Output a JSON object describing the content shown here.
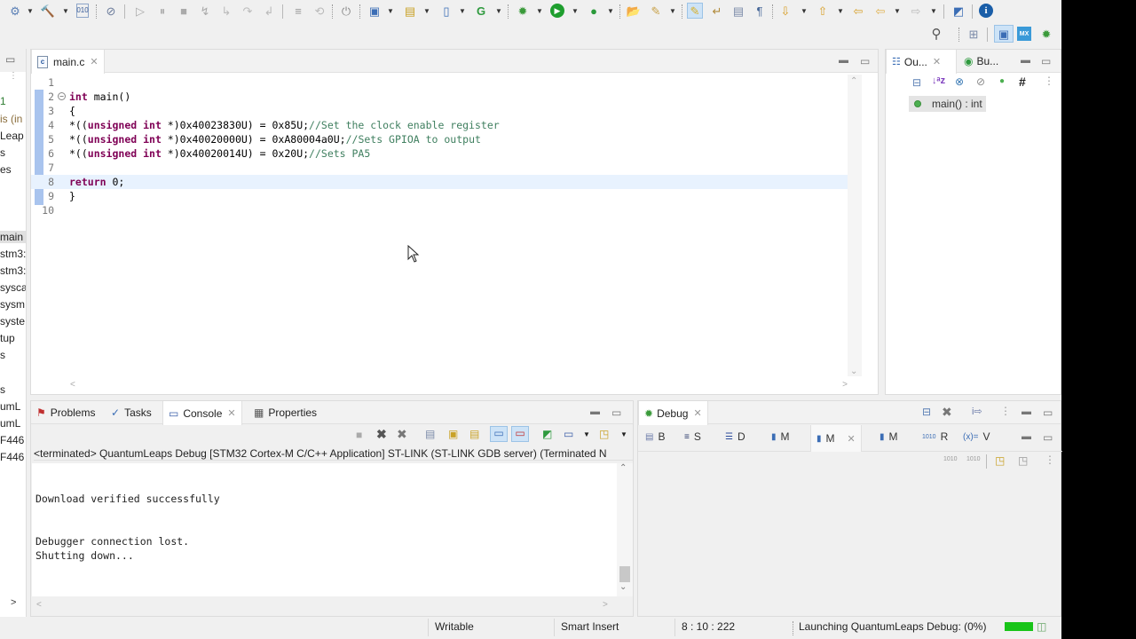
{
  "toolbar": {
    "row1_icons": [
      "debug-config-icon",
      "build-hammer-icon",
      "binary-file-icon",
      "skip-breakpoints-icon",
      "resume-icon",
      "suspend-icon",
      "terminate-icon",
      "disconnect-icon",
      "step-into-icon",
      "step-over-icon",
      "step-return-icon",
      "instruction-stepping-icon",
      "restart-icon",
      "new-c-project-icon",
      "new-source-folder-icon",
      "new-c-file-icon",
      "new-class-icon",
      "debug-icon",
      "run-icon",
      "external-tools-icon",
      "open-type-icon",
      "search-icon",
      "toggle-mark-occurrences-icon",
      "toggle-word-wrap-icon",
      "block-selection-icon",
      "show-whitespace-icon",
      "next-annotation-icon",
      "previous-annotation-icon",
      "last-edit-location-icon",
      "back-icon",
      "forward-icon",
      "open-perspective-icon",
      "info-icon"
    ],
    "row2_icons": [
      "search-icon",
      "open-perspective-icon",
      "cpp-perspective-icon",
      "cubemx-perspective-icon",
      "debug-perspective-icon"
    ],
    "row2_mx_label": "MX"
  },
  "left_panel": {
    "items": [
      "1",
      "is (in",
      "Leap",
      "s",
      "es",
      "main",
      "stm3:",
      "stm3:",
      "sysca",
      "sysm",
      "syste",
      "tup",
      "s",
      "s",
      "umL",
      "umL",
      "F446",
      "F446"
    ]
  },
  "editor": {
    "tab_label": "main.c",
    "file_icon_label": "c",
    "lines": [
      {
        "num": "1",
        "tokens": []
      },
      {
        "num": "2",
        "tokens": [
          {
            "t": "kw",
            "v": "int"
          },
          {
            "t": "n",
            "v": " main()"
          }
        ],
        "fold": true
      },
      {
        "num": "3",
        "tokens": [
          {
            "t": "n",
            "v": "{"
          }
        ]
      },
      {
        "num": "4",
        "tokens": [
          {
            "t": "n",
            "v": "*(("
          },
          {
            "t": "kw",
            "v": "unsigned int"
          },
          {
            "t": "n",
            "v": " *)0x40023830U) = 0x85U;"
          },
          {
            "t": "cm",
            "v": "//Set the clock enable register"
          }
        ]
      },
      {
        "num": "5",
        "tokens": [
          {
            "t": "n",
            "v": "*(("
          },
          {
            "t": "kw",
            "v": "unsigned int"
          },
          {
            "t": "n",
            "v": " *)0x40020000U) = 0xA80004a0U;"
          },
          {
            "t": "cm",
            "v": "//Sets GPIOA to output"
          }
        ]
      },
      {
        "num": "6",
        "tokens": [
          {
            "t": "n",
            "v": "*(("
          },
          {
            "t": "kw",
            "v": "unsigned int"
          },
          {
            "t": "n",
            "v": " *)0x40020014U) = 0x20U;"
          },
          {
            "t": "cm",
            "v": "//Sets PA5"
          }
        ]
      },
      {
        "num": "7",
        "tokens": []
      },
      {
        "num": "8",
        "tokens": [
          {
            "t": "kw",
            "v": "return"
          },
          {
            "t": "n",
            "v": " 0;"
          }
        ],
        "current": true
      },
      {
        "num": "9",
        "tokens": [
          {
            "t": "n",
            "v": "}"
          }
        ]
      },
      {
        "num": "10",
        "tokens": []
      }
    ]
  },
  "outline": {
    "tab_outline": "Ou...",
    "tab_build": "Bu...",
    "item": "main() : int"
  },
  "console": {
    "tabs": [
      "Problems",
      "Tasks",
      "Console",
      "Properties"
    ],
    "active_tab": "Console",
    "launch_description": "<terminated> QuantumLeaps Debug [STM32 Cortex-M C/C++ Application] ST-LINK (ST-LINK GDB server) (Terminated N",
    "lines": [
      "Download verified successfully",
      "Debugger connection lost.",
      "Shutting down..."
    ]
  },
  "debug": {
    "tab_label": "Debug",
    "views": [
      {
        "label": "B",
        "icon": "breakpoints-icon"
      },
      {
        "label": "S",
        "icon": "sfrs-icon"
      },
      {
        "label": "D",
        "icon": "disassembly-icon"
      },
      {
        "label": "M",
        "icon": "memory-icon"
      },
      {
        "label": "M",
        "icon": "memory-icon",
        "active": true
      },
      {
        "label": "M",
        "icon": "memory-icon"
      },
      {
        "label": "R",
        "icon": "registers-icon"
      },
      {
        "label": "V",
        "icon": "variables-icon"
      }
    ]
  },
  "statusbar": {
    "writable": "Writable",
    "insert_mode": "Smart Insert",
    "position": "8 : 10 : 222",
    "launching": "Launching QuantumLeaps Debug: (0%)",
    "progress_percent": 100,
    "progress_color": "#19c419"
  }
}
